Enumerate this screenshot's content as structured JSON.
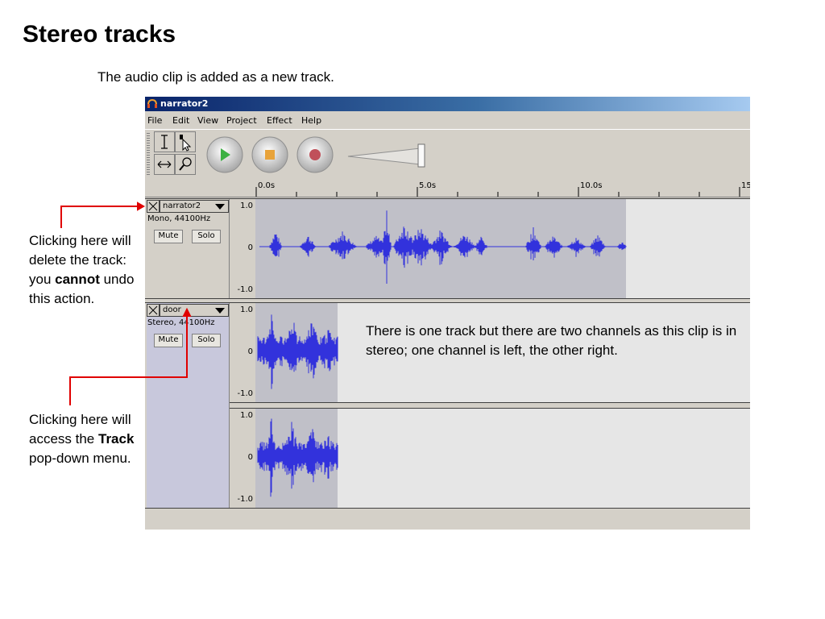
{
  "slide": {
    "title": "Stereo tracks",
    "subtitle": "The audio clip is added as a new track.",
    "note_delete": [
      "Clicking here will delete the track: you ",
      "cannot",
      " undo this action."
    ],
    "note_track_menu": [
      "Clicking here will access the ",
      "Track",
      " pop-down menu."
    ],
    "note_channels": "There is one track but there are two channels as this clip is in stereo; one channel is left, the other right."
  },
  "window": {
    "title": "narrator2",
    "icon": "audacity-app-icon"
  },
  "menu": [
    "File",
    "Edit",
    "View",
    "Project",
    "Effect",
    "Help"
  ],
  "tools": [
    {
      "name": "selection-tool",
      "icon": "i-beam-icon"
    },
    {
      "name": "envelope-tool",
      "icon": "envelope-icon"
    },
    {
      "name": "time-shift-tool",
      "icon": "double-arrow-icon"
    },
    {
      "name": "zoom-tool",
      "icon": "magnifier-icon"
    }
  ],
  "transport": {
    "play_icon": "play-icon",
    "stop_icon": "stop-icon",
    "record_icon": "record-icon",
    "colors": {
      "play": "#3cb043",
      "stop": "#e8a33a",
      "record": "#c0505a"
    }
  },
  "ruler": {
    "labels": [
      "0.0s",
      "5.0s",
      "10.0s",
      "15"
    ]
  },
  "tracks": [
    {
      "name": "narrator2",
      "format": "Mono, 44100Hz",
      "mute": "Mute",
      "solo": "Solo",
      "channels": [
        {
          "scale": [
            "1.0",
            "0",
            "-1.0"
          ]
        }
      ]
    },
    {
      "name": "door",
      "format": "Stereo, 44100Hz",
      "mute": "Mute",
      "solo": "Solo",
      "channels": [
        {
          "scale": [
            "1.0",
            "0",
            "-1.0"
          ]
        },
        {
          "scale": [
            "1.0",
            "0",
            "-1.0"
          ]
        }
      ]
    }
  ],
  "colors": {
    "waveform": "#3232dc",
    "annotation_arrow": "#e00000"
  }
}
